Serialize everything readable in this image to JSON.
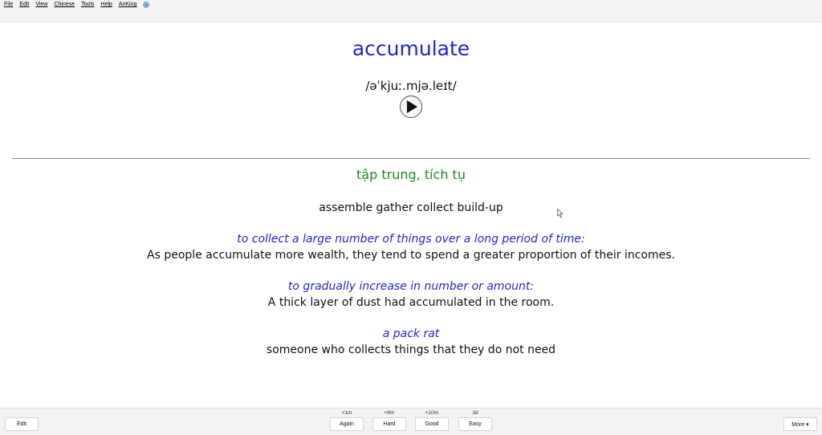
{
  "menubar": {
    "items": [
      "File",
      "Edit",
      "View",
      "Chinese",
      "Tools",
      "Help",
      "AnKing"
    ],
    "sync_icon": "sync-icon"
  },
  "card": {
    "word": "accumulate",
    "ipa": "/əˈkjuː.mjə.leɪt/",
    "play_icon": "play-icon",
    "meaning": "tập trung, tích tụ",
    "synonyms": "assemble gather collect build-up",
    "definitions": [
      {
        "definition": "to collect a large number of things over a  long period of time:",
        "example": "As people accumulate more wealth, they tend to spend a greater proportion of their incomes."
      },
      {
        "definition": "to gradually increase in number or amount:",
        "example": "A thick layer of dust had accumulated in the room."
      },
      {
        "definition": "a pack rat",
        "example": "someone who collects things that they do not need"
      }
    ],
    "colors": {
      "word": "#2323d8",
      "meaning": "#238a23",
      "definition": "#2323d8"
    }
  },
  "bottombar": {
    "edit_label": "Edit",
    "more_label": "More ▾",
    "answers": [
      {
        "interval": "<1m",
        "label": "Again"
      },
      {
        "interval": "<6m",
        "label": "Hard"
      },
      {
        "interval": "<10m",
        "label": "Good"
      },
      {
        "interval": "3d",
        "label": "Easy"
      }
    ]
  }
}
